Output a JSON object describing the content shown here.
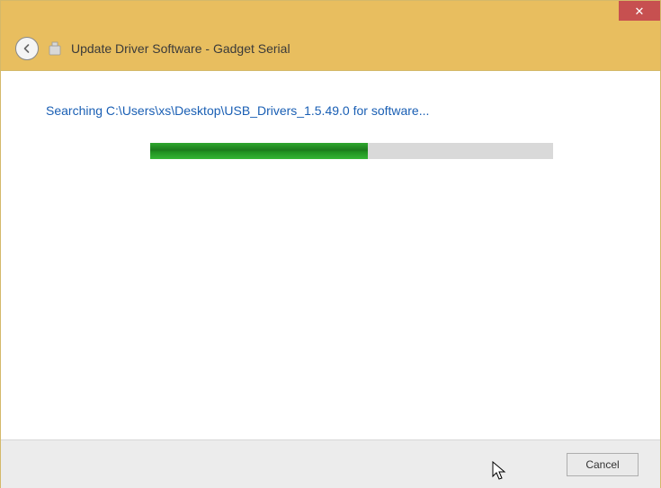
{
  "titlebar": {
    "close_glyph": "✕"
  },
  "header": {
    "title": "Update Driver Software - Gadget Serial"
  },
  "content": {
    "status_text": "Searching C:\\Users\\xs\\Desktop\\USB_Drivers_1.5.49.0 for software...",
    "progress_percent": 54
  },
  "footer": {
    "cancel_label": "Cancel"
  },
  "colors": {
    "accent_header": "#e8be5f",
    "close_bg": "#c75050",
    "link_text": "#1a5fb4",
    "progress_fill": "#209020"
  }
}
